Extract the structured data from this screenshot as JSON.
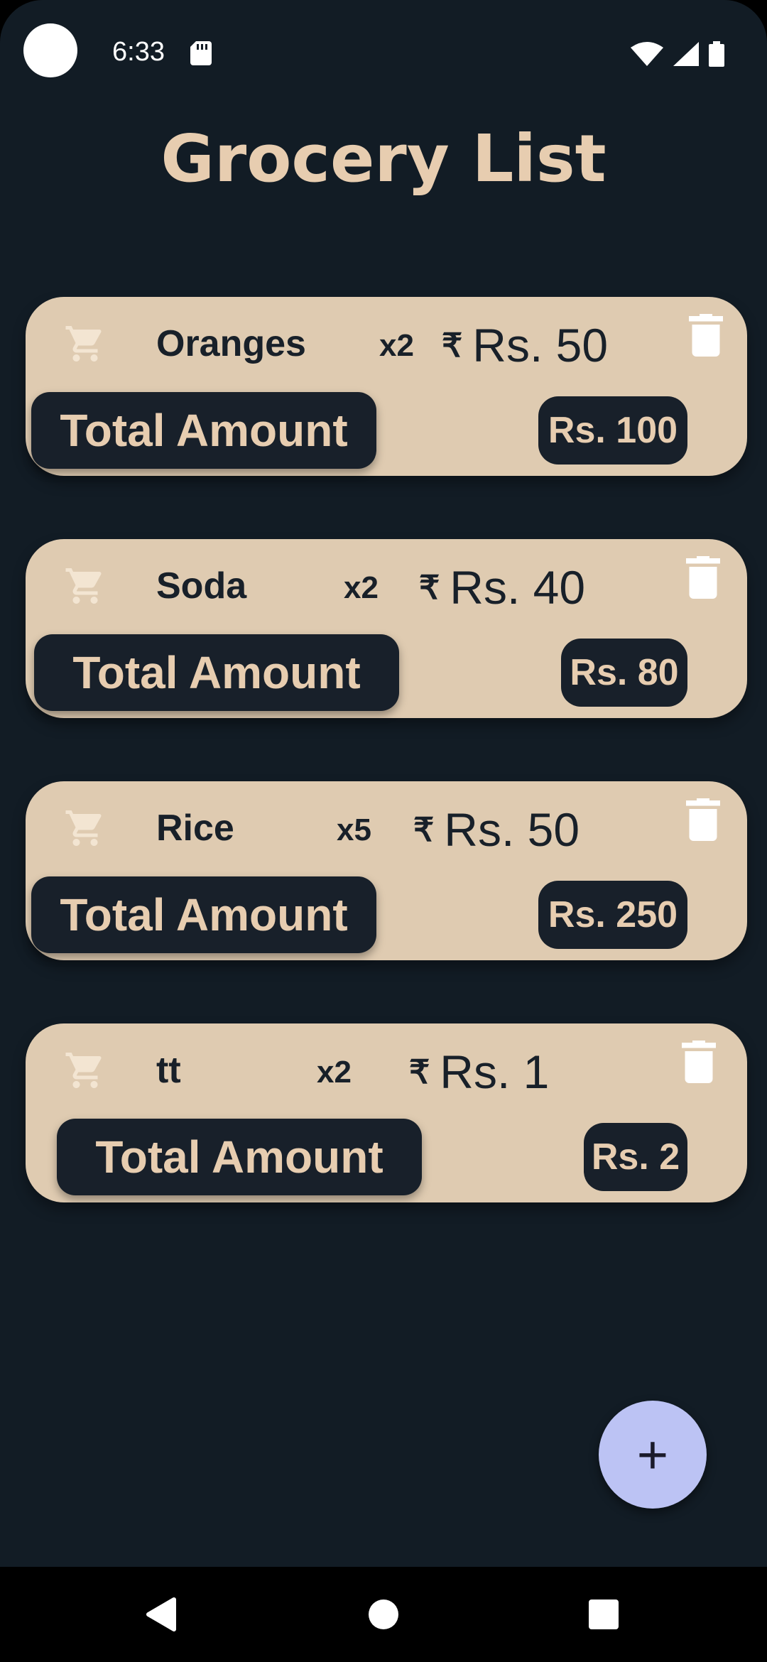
{
  "status": {
    "time": "6:33"
  },
  "title": "Grocery List",
  "items": [
    {
      "name": "Oranges",
      "qty": "x2",
      "price": "Rs. 50",
      "total_label": "Total Amount",
      "total": "Rs. 100"
    },
    {
      "name": "Soda",
      "qty": "x2",
      "price": "Rs. 40",
      "total_label": "Total Amount",
      "total": "Rs. 80"
    },
    {
      "name": "Rice",
      "qty": "x5",
      "price": "Rs. 50",
      "total_label": "Total Amount",
      "total": "Rs. 250"
    },
    {
      "name": "tt",
      "qty": "x2",
      "price": "Rs. 1",
      "total_label": "Total Amount",
      "total": "Rs. 2"
    }
  ],
  "fab": {
    "label": "+"
  },
  "currency_symbol": "₹",
  "colors": {
    "background": "#121c25",
    "card": "#dfcbb1",
    "accent": "#e7cdb0",
    "dark": "#182029",
    "fab": "#bcc3f4"
  },
  "icons": [
    "cart-icon",
    "trash-icon",
    "rupee-icon",
    "plus-icon",
    "back-icon",
    "home-icon",
    "recents-icon",
    "wifi-icon",
    "signal-icon",
    "battery-icon",
    "sd-card-icon"
  ]
}
